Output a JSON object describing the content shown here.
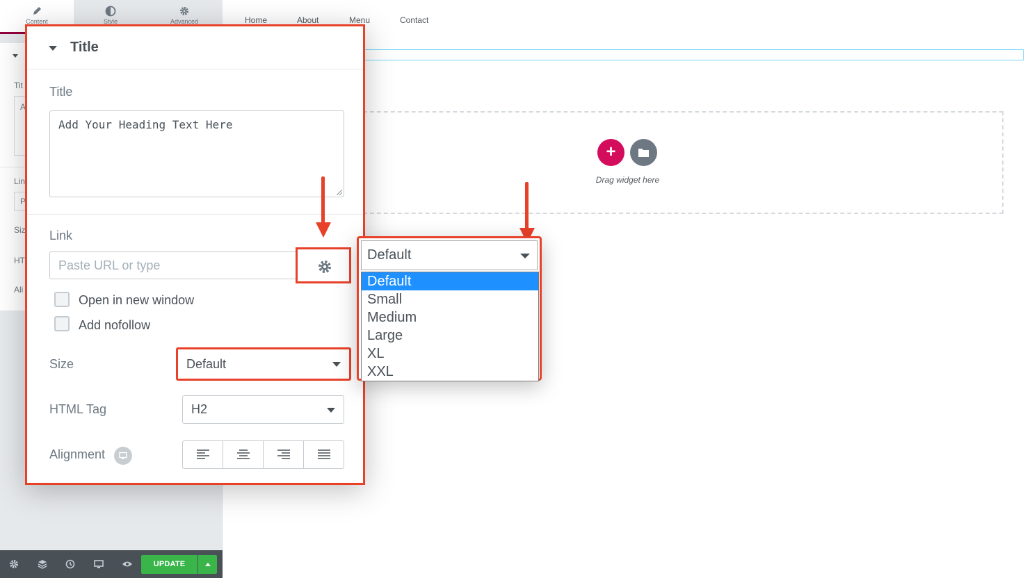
{
  "sidebar": {
    "tabs": [
      {
        "label": "Content",
        "icon": "pencil-icon"
      },
      {
        "label": "Style",
        "icon": "half-circle-icon"
      },
      {
        "label": "Advanced",
        "icon": "gear-icon"
      }
    ],
    "behind_labels": {
      "title": "Tit",
      "title_value": "A",
      "link": "Lin",
      "link_value": "P",
      "size": "Siz",
      "html": "HT",
      "align": "Ali"
    }
  },
  "bottom_bar": {
    "icons": [
      "settings-icon",
      "layers-icon",
      "history-icon",
      "responsive-icon",
      "preview-eye-icon"
    ],
    "update_label": "UPDATE"
  },
  "preview": {
    "nav": [
      "Home",
      "About",
      "Menu",
      "Contact"
    ],
    "drag_widget_text": "Drag widget here",
    "add_symbol": "+"
  },
  "panel": {
    "section_title": "Title",
    "title_label": "Title",
    "title_value": "Add Your Heading Text Here",
    "link_label": "Link",
    "link_placeholder": "Paste URL or type",
    "open_new_window": "Open in new window",
    "add_nofollow": "Add nofollow",
    "size_label": "Size",
    "size_value": "Default",
    "html_tag_label": "HTML Tag",
    "html_tag_value": "H2",
    "alignment_label": "Alignment"
  },
  "dropdown": {
    "selected": "Default",
    "options": [
      "Default",
      "Small",
      "Medium",
      "Large",
      "XL",
      "XXL"
    ]
  },
  "colors": {
    "accent_red": "#e8412a",
    "update_green": "#39b54a",
    "add_pink": "#d30c5c",
    "selected_blue": "#1e90ff"
  }
}
